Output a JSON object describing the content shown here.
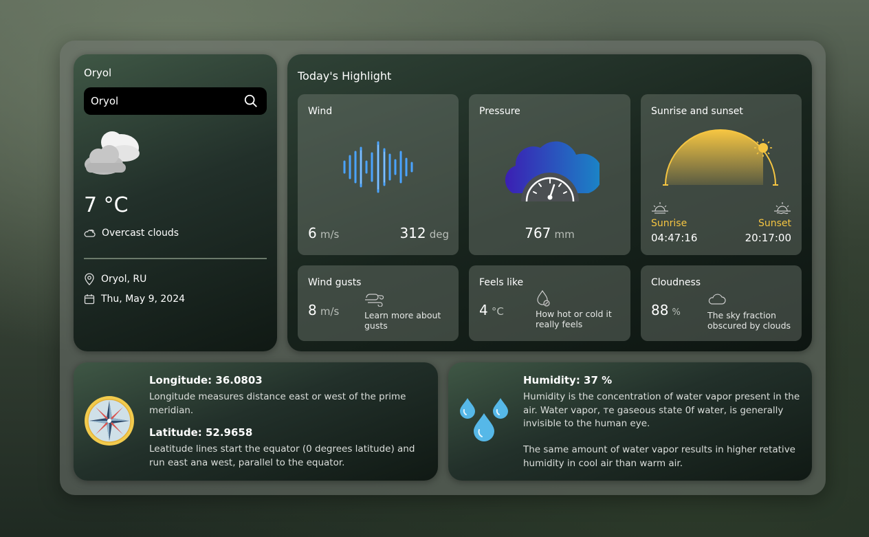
{
  "sidebar": {
    "city_title": "Oryol",
    "search_value": "Oryol",
    "temperature": "7 °C",
    "condition": "Overcast clouds",
    "location": "Oryol, RU",
    "date": "Thu, May 9, 2024"
  },
  "highlights": {
    "title": "Today's Highlight",
    "wind": {
      "title": "Wind",
      "speed": "6",
      "speed_unit": "m/s",
      "direction": "312",
      "direction_unit": "deg"
    },
    "pressure": {
      "title": "Pressure",
      "value": "767",
      "unit": "mm"
    },
    "sun": {
      "title": "Sunrise and sunset",
      "sunrise_label": "Sunrise",
      "sunrise_time": "04:47:16",
      "sunset_label": "Sunset",
      "sunset_time": "20:17:00"
    },
    "gusts": {
      "title": "Wind gusts",
      "value": "8",
      "unit": "m/s",
      "desc": "Learn more about gusts"
    },
    "feels": {
      "title": "Feels like",
      "value": "4",
      "unit": "°C",
      "desc": "How hot or cold it really feels"
    },
    "cloudness": {
      "title": "Cloudness",
      "value": "88",
      "unit": "%",
      "desc": "The sky fraction obscured by clouds"
    }
  },
  "coords": {
    "longitude_head": "Longitude: 36.0803",
    "longitude_text": "Longitude measures distance east or west of the prime meridian.",
    "latitude_head": "Latitude: 52.9658",
    "latitude_text": "Leatitude lines start the equator (0 degrees latitude) and run east ana west, parallel to the equator."
  },
  "humidity": {
    "head": "Humidity: 37 %",
    "text1": "Humidity is the concentration of water vapor present in the air. Water vapor, тe gaseous state 0f water, is generally invisible to the human eye.",
    "text2": "The same amount of water vapor results in higher retative humidity in cool air than warm air."
  },
  "colors": {
    "accent_yellow": "#f5c542",
    "wave_blue": "#3d8bff",
    "drop_blue": "#5cc6ee"
  }
}
